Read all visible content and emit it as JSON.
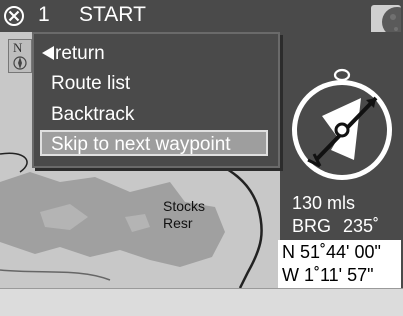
{
  "titlebar": {
    "close_icon": "close-circle-icon",
    "number": "1",
    "title": "START",
    "badge_icon": "moon-icon"
  },
  "map": {
    "north_label": "N",
    "place_name_line1": "Stocks",
    "place_name_line2": "Resr"
  },
  "menu": {
    "return_label": "return",
    "route_list_label": "Route list",
    "backtrack_label": "Backtrack",
    "skip_label": "Skip to next waypoint"
  },
  "navigation": {
    "distance": "130 mls",
    "bearing_label": "BRG",
    "bearing_value": "235˚",
    "latitude": "N 51˚44' 00\"",
    "longitude": "W   1˚11' 57\""
  },
  "colors": {
    "panel": "#4a4a4a",
    "map_land": "#c8c8c8",
    "map_water": "#a0a0a0",
    "highlight": "#9e9e9e"
  }
}
